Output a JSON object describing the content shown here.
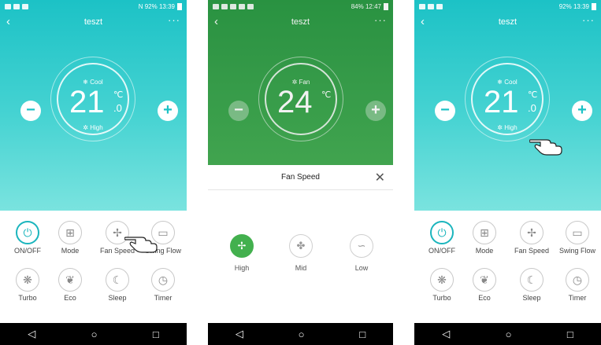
{
  "phones": [
    {
      "status": {
        "right_text": "N 92% 13:39"
      },
      "title": "teszt",
      "more": "···",
      "back": "‹",
      "mode": "❄ Cool",
      "temp": "21",
      "unit": "℃",
      "decimal": ".0",
      "fan": "High",
      "minus": "−",
      "plus": "+",
      "controls": {
        "onoff": "ON/OFF",
        "mode": "Mode",
        "fan_speed": "Fan Speed",
        "swing": "Swing Flow",
        "turbo": "Turbo",
        "eco": "Eco",
        "sleep": "Sleep",
        "timer": "Timer"
      }
    },
    {
      "status": {
        "right_text": "84% 12:47"
      },
      "title": "teszt",
      "more": "···",
      "back": "‹",
      "mode": "Fan",
      "temp": "24",
      "unit": "℃",
      "minus": "−",
      "plus": "+",
      "sheet": {
        "title": "Fan Speed",
        "close": "✕",
        "options": [
          "High",
          "Mid",
          "Low"
        ],
        "selected": "High"
      }
    },
    {
      "status": {
        "right_text": "92% 13:39"
      },
      "title": "teszt",
      "more": "···",
      "back": "‹",
      "mode": "❄ Cool",
      "temp": "21",
      "unit": "℃",
      "decimal": ".0",
      "fan": "High",
      "minus": "−",
      "plus": "+",
      "controls": {
        "onoff": "ON/OFF",
        "mode": "Mode",
        "fan_speed": "Fan Speed",
        "swing": "Swing Flow",
        "turbo": "Turbo",
        "eco": "Eco",
        "sleep": "Sleep",
        "timer": "Timer"
      }
    }
  ],
  "android_nav": {
    "back": "◁",
    "home": "○",
    "recents": "□"
  },
  "icons": {
    "power": "power-icon",
    "mode": "grid-icon",
    "fan": "fan-icon",
    "swing": "swing-icon",
    "turbo": "snowflake-icon",
    "eco": "leaf-icon",
    "sleep": "moon-icon",
    "timer": "timer-icon"
  },
  "colors": {
    "teal": "#1cc2c6",
    "green": "#43b04e",
    "active_ring": "#1bb5bd"
  }
}
